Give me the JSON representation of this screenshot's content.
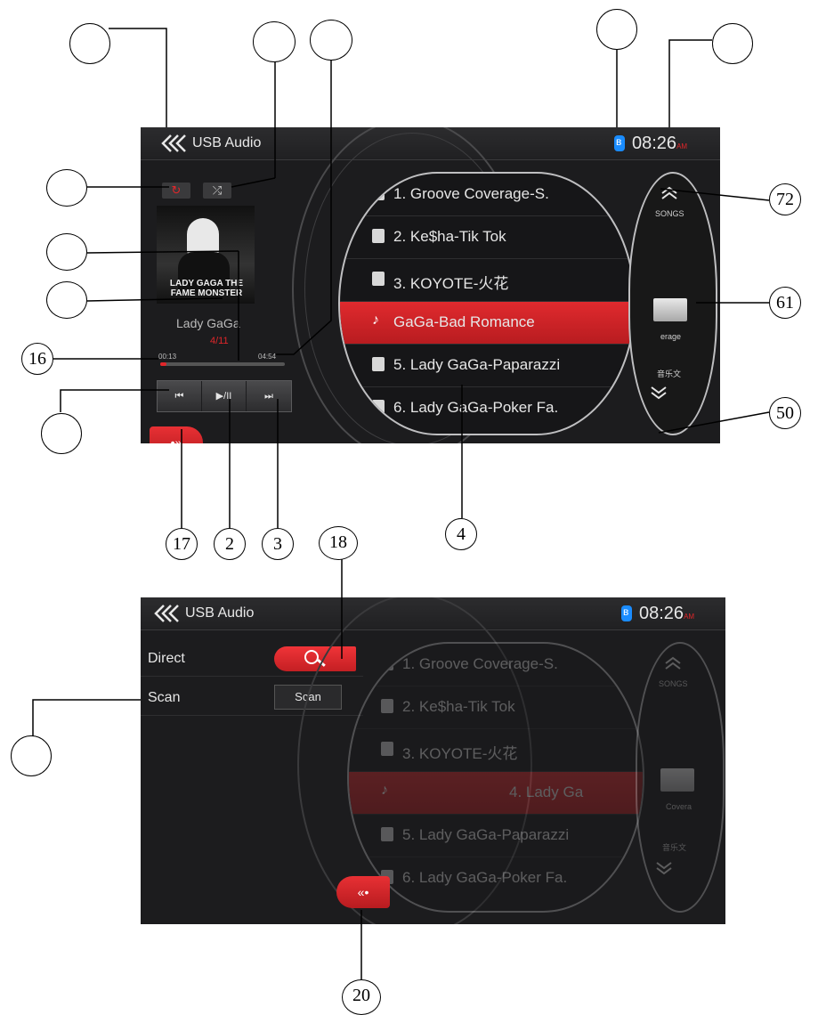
{
  "screen1": {
    "title": "USB Audio",
    "clock": "08:26",
    "ampm": "AM",
    "playlist": [
      {
        "label": "1. Groove Coverage-S.",
        "selected": false
      },
      {
        "label": "2. Ke$ha-Tik Tok",
        "selected": false
      },
      {
        "label": "3. KOYOTE-火花",
        "selected": false
      },
      {
        "label": "GaGa-Bad Romance",
        "selected": true
      },
      {
        "label": "5. Lady GaGa-Paparazzi",
        "selected": false
      },
      {
        "label": "6. Lady GaGa-Poker Fa.",
        "selected": false
      }
    ],
    "right_panel": {
      "songs_label": "SONGS",
      "folder_label": "erage",
      "bottom_label": "音乐文"
    },
    "album_text": "LADY GAGA THE FAME MONSTER",
    "artist": "Lady GaGa",
    "track_counter": "4/11",
    "time_elapsed": "00:13",
    "time_total": "04:54",
    "progress": 0.05,
    "controls": {
      "prev": "⏮",
      "play_pause": "▶/II",
      "next": "⏭"
    },
    "repeat_icon": "↻",
    "shuffle_icon": "⤮",
    "menu_tab_icon": "•»"
  },
  "screen2": {
    "title": "USB Audio",
    "clock": "08:26",
    "ampm": "AM",
    "menu": [
      {
        "label": "Direct"
      },
      {
        "label": "Scan"
      }
    ],
    "scan_button": "Scan",
    "playlist": [
      {
        "label": "1. Groove Coverage-S.",
        "selected": false
      },
      {
        "label": "2. Ke$ha-Tik Tok",
        "selected": false
      },
      {
        "label": "3. KOYOTE-火花",
        "selected": false
      },
      {
        "label": "4. Lady Ga",
        "selected": true
      },
      {
        "label": "5. Lady GaGa-Paparazzi",
        "selected": false
      },
      {
        "label": "6. Lady GaGa-Poker Fa.",
        "selected": false
      }
    ],
    "right_panel": {
      "songs_label": "SONGS",
      "folder_label": "Covera",
      "bottom_label": "音乐文"
    },
    "close_tab_icon": "«•"
  },
  "callouts": [
    "72",
    "61",
    "16",
    "50",
    "17",
    "2",
    "3",
    "4",
    "18",
    "20"
  ],
  "colors": {
    "accent": "#e0262a",
    "bluetooth": "#1a8cff",
    "background": "#1c1c1e"
  }
}
